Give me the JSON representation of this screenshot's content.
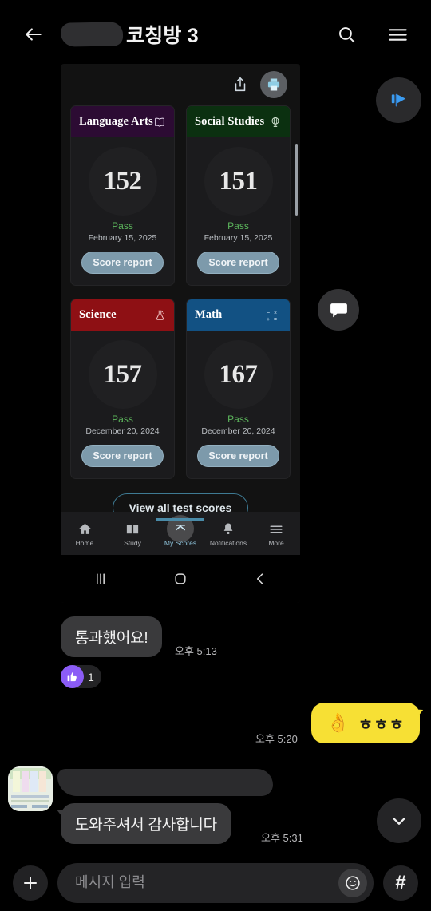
{
  "header": {
    "back_icon": "back-arrow-icon",
    "redacted_name": "",
    "title": "코칭방 3",
    "search_icon": "search-icon",
    "menu_icon": "hamburger-menu-icon"
  },
  "floating": {
    "announce_icon": "announcement-flag-icon",
    "chat_icon": "chat-bubble-icon",
    "scroll_down_icon": "chevron-down-icon"
  },
  "screenshot": {
    "toolbar": {
      "share_icon": "share-icon",
      "print_icon": "print-icon"
    },
    "cards": [
      {
        "subject": "Language Arts",
        "icon": "open-book-icon",
        "icon_glyph": "📖",
        "header_color": "#2c0b33",
        "score": "152",
        "status": "Pass",
        "date": "February 15, 2025",
        "button": "Score report"
      },
      {
        "subject": "Social Studies",
        "icon": "globe-icon",
        "icon_glyph": "🌍",
        "header_color": "#0b3010",
        "score": "151",
        "status": "Pass",
        "date": "February 15, 2025",
        "button": "Score report"
      },
      {
        "subject": "Science",
        "icon": "flask-icon",
        "icon_glyph": "⚗",
        "header_color": "#8e1014",
        "score": "157",
        "status": "Pass",
        "date": "December 20, 2024",
        "button": "Score report"
      },
      {
        "subject": "Math",
        "icon": "math-symbols-icon",
        "icon_glyph": "",
        "header_color": "#125183",
        "score": "167",
        "status": "Pass",
        "date": "December 20, 2024",
        "button": "Score report"
      }
    ],
    "view_all_label": "View all test scores",
    "app_nav": [
      {
        "label": "Home",
        "icon": "home-icon",
        "active": false
      },
      {
        "label": "Study",
        "icon": "open-book-icon",
        "active": false
      },
      {
        "label": "My Scores",
        "icon": "chevron-up-icon",
        "active": true
      },
      {
        "label": "Notifications",
        "icon": "bell-icon",
        "active": false
      },
      {
        "label": "More",
        "icon": "hamburger-menu-icon",
        "active": false
      }
    ],
    "system_nav": {
      "recents_icon": "recent-apps-icon",
      "home_icon": "home-square-icon",
      "back_icon": "back-chevron-icon"
    }
  },
  "messages": {
    "m1_text": "통과했어요!",
    "m1_time": "오후 5:13",
    "reaction_icon": "thumbs-up-icon",
    "reaction_glyph": "👍",
    "reaction_count": "1",
    "m2_emoji": "👌",
    "m2_text": "ㅎㅎㅎ",
    "m2_time": "오후 5:20",
    "m3_text": "도와주셔서 감사합니다",
    "m3_time": "오후 5:31",
    "avatar_name": "avatar"
  },
  "input": {
    "plus_icon": "plus-icon",
    "placeholder": "메시지 입력",
    "value": "",
    "emoji_icon": "smiley-face-icon",
    "hash_label": "#"
  },
  "colors": {
    "background": "#000000",
    "bubble_in": "#3a3a3c",
    "bubble_out": "#f7e034",
    "reaction_purple": "#8b5cf6",
    "pass_green": "#5db85d",
    "accent_blue": "#4a8ba8"
  }
}
